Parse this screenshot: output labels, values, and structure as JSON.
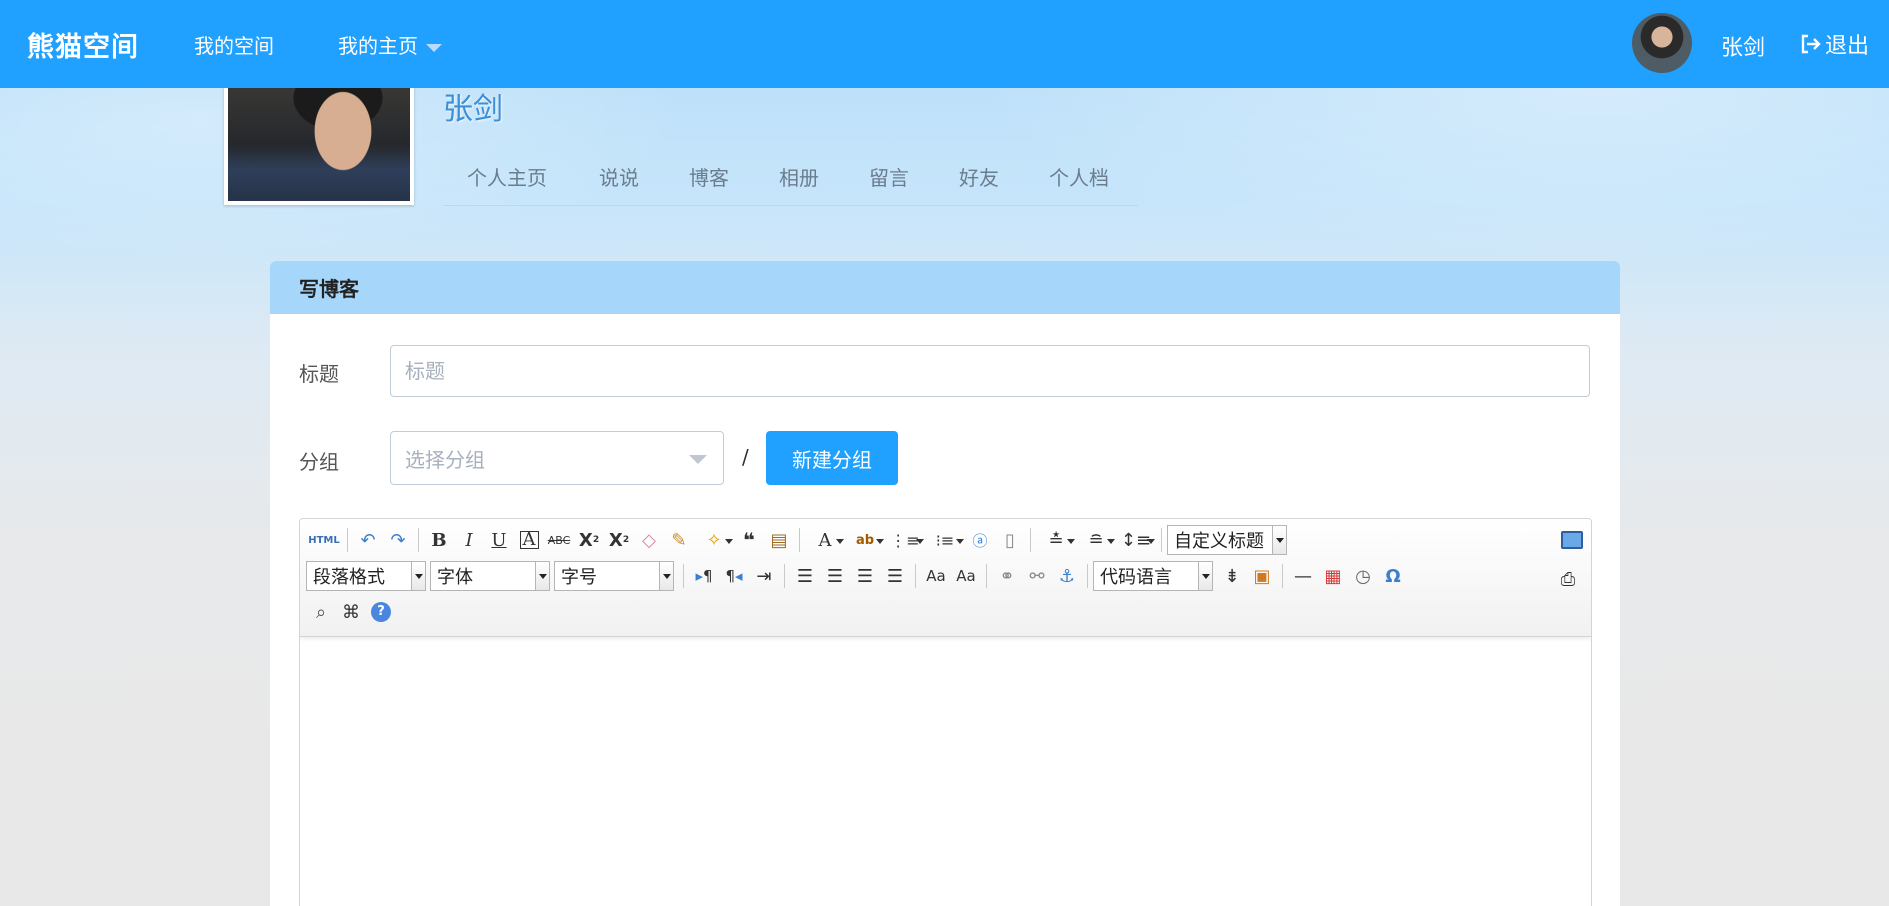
{
  "nav": {
    "brand": "熊猫空间",
    "items": [
      "我的空间",
      "我的主页"
    ],
    "username": "张剑",
    "logout": "退出"
  },
  "profile": {
    "name": "张剑",
    "tabs": [
      "个人主页",
      "说说",
      "博客",
      "相册",
      "留言",
      "好友",
      "个人档"
    ]
  },
  "panel": {
    "title": "写博客",
    "title_label": "标题",
    "title_placeholder": "标题",
    "group_label": "分组",
    "group_placeholder": "选择分组",
    "separator": "/",
    "new_group_button": "新建分组"
  },
  "editor": {
    "html_label": "HTML",
    "custom_heading": "自定义标题",
    "paragraph_format": "段落格式",
    "font_family": "字体",
    "font_size": "字号",
    "code_language": "代码语言"
  },
  "colors": {
    "primary": "#20a0ff",
    "panel_header": "#a6d7fb"
  }
}
